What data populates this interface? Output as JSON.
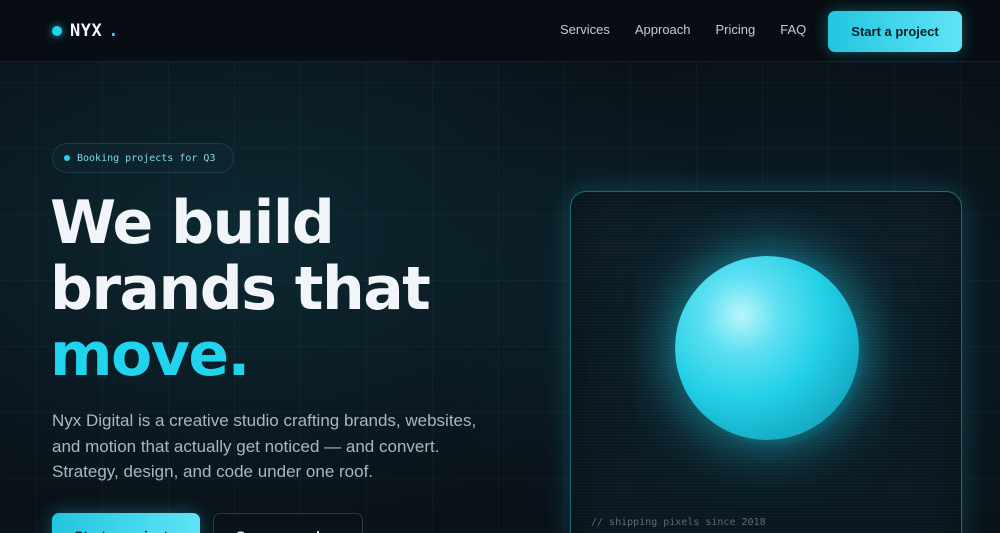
{
  "brand": {
    "name": "NYX",
    "suffix": "."
  },
  "nav": {
    "links": [
      "Services",
      "Approach",
      "Pricing",
      "FAQ"
    ],
    "cta_label": "Start a project"
  },
  "hero": {
    "badge": "Booking projects for Q3",
    "headline_line1": "We build",
    "headline_line2": "brands that",
    "headline_accent": "move.",
    "lead": "Nyx Digital is a creative studio crafting brands, websites, and motion that actually get noticed — and convert. Strategy, design, and code under one roof.",
    "primary_button": "Start a project",
    "secondary_button": "See our work"
  },
  "visual": {
    "caption": "// shipping pixels since 2018"
  },
  "colors": {
    "accent": "#22d3ee",
    "background": "#0a1118",
    "nav_background": "#070d12"
  }
}
